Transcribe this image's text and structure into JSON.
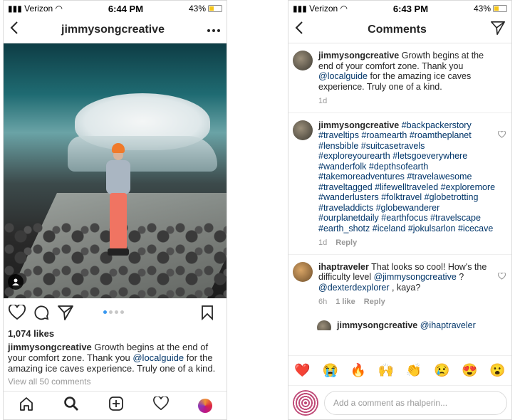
{
  "left": {
    "status": {
      "carrier": "Verizon",
      "time": "6:44 PM",
      "battery": "43%"
    },
    "nav": {
      "title": "jimmysongcreative"
    },
    "post": {
      "likes": "1,074 likes",
      "caption_user": "jimmysongcreative",
      "caption_pre": " Growth begins at the end of your comfort zone. Thank you ",
      "caption_mention": "@localguide",
      "caption_post": " for the amazing ice caves experience. Truly one of a kind.",
      "view_all": "View all 50 comments",
      "carousel_index": 1,
      "carousel_count": 4
    }
  },
  "right": {
    "status": {
      "carrier": "Verizon",
      "time": "6:43 PM",
      "battery": "43%"
    },
    "nav": {
      "title": "Comments"
    },
    "comments": [
      {
        "user": "jimmysongcreative",
        "text_pre": " Growth begins at the end of your comfort zone. Thank you ",
        "mention": "@localguide",
        "text_post": " for the amazing ice caves experience. Truly one of a kind.",
        "time": "1d"
      },
      {
        "user": "jimmysongcreative",
        "hashtags": "#backpackerstory #traveltips #roamearth #roamtheplanet #lensbible #suitcasetravels #exploreyourearth #letsgoeverywhere #wanderfolk #depthsofearth #takemoreadventures #travelawesome #traveltagged #lifewelltraveled #exploremore #wanderlusters #folktravel #globetrotting #traveladdicts #globewanderer #ourplanetdaily #earthfocus #travelscape #earth_shotz #iceland #jokulsarlon #icecave",
        "time": "1d",
        "reply": "Reply"
      },
      {
        "user": "ihaptraveler",
        "text_pre": " That looks so cool! How's the difficulty level ",
        "mention1": "@jimmysongcreative",
        "text_mid": " ? ",
        "mention2": "@dexterdexplorer",
        "text_post": " , kaya?",
        "time": "6h",
        "likes": "1 like",
        "reply": "Reply"
      },
      {
        "user": "jimmysongcreative",
        "mention": "@ihaptraveler"
      }
    ],
    "emojis": [
      "❤️",
      "😭",
      "🔥",
      "🙌",
      "👏",
      "😢",
      "😍",
      "😮"
    ],
    "input": {
      "placeholder": "Add a comment as rhalperin..."
    }
  },
  "colors": {
    "link": "#003569",
    "accent": "#3897f0",
    "muted": "#999999"
  }
}
